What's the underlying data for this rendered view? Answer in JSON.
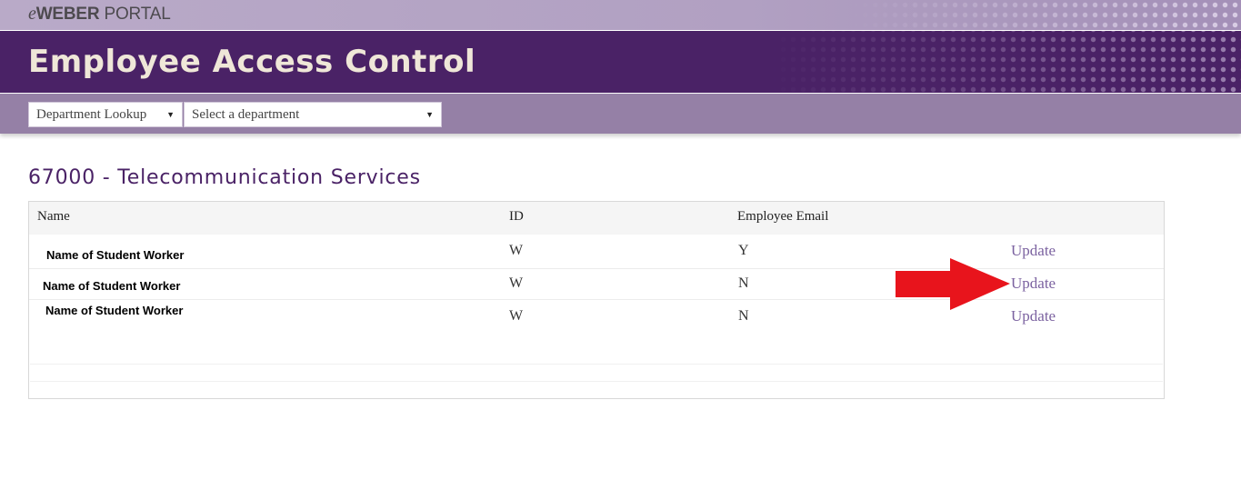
{
  "portal": {
    "e": "e",
    "weber": "WEBER",
    "portal": " PORTAL"
  },
  "page_title": "Employee Access Control",
  "toolbar": {
    "lookup_label": "Department Lookup",
    "department_placeholder": "Select a department"
  },
  "department_heading": "67000 - Telecommunication Services",
  "table": {
    "headers": {
      "name": "Name",
      "id": "ID",
      "email": "Employee Email"
    },
    "rows": [
      {
        "name": "Name of Student Worker",
        "id": "W",
        "email": "Y",
        "action": "Update"
      },
      {
        "name": "Name of Student Worker",
        "id": "W",
        "email": "N",
        "action": "Update"
      },
      {
        "name": "Name of Student Worker",
        "id": "W",
        "email": "N",
        "action": "Update"
      }
    ]
  },
  "colors": {
    "banner": "#4a2266",
    "toolbar": "#9580a6",
    "link": "#7b62a0",
    "annotation_arrow": "#e8141c"
  },
  "icons": {
    "dropdown_caret": "caret-down-icon",
    "annotation": "red-arrow-icon"
  }
}
